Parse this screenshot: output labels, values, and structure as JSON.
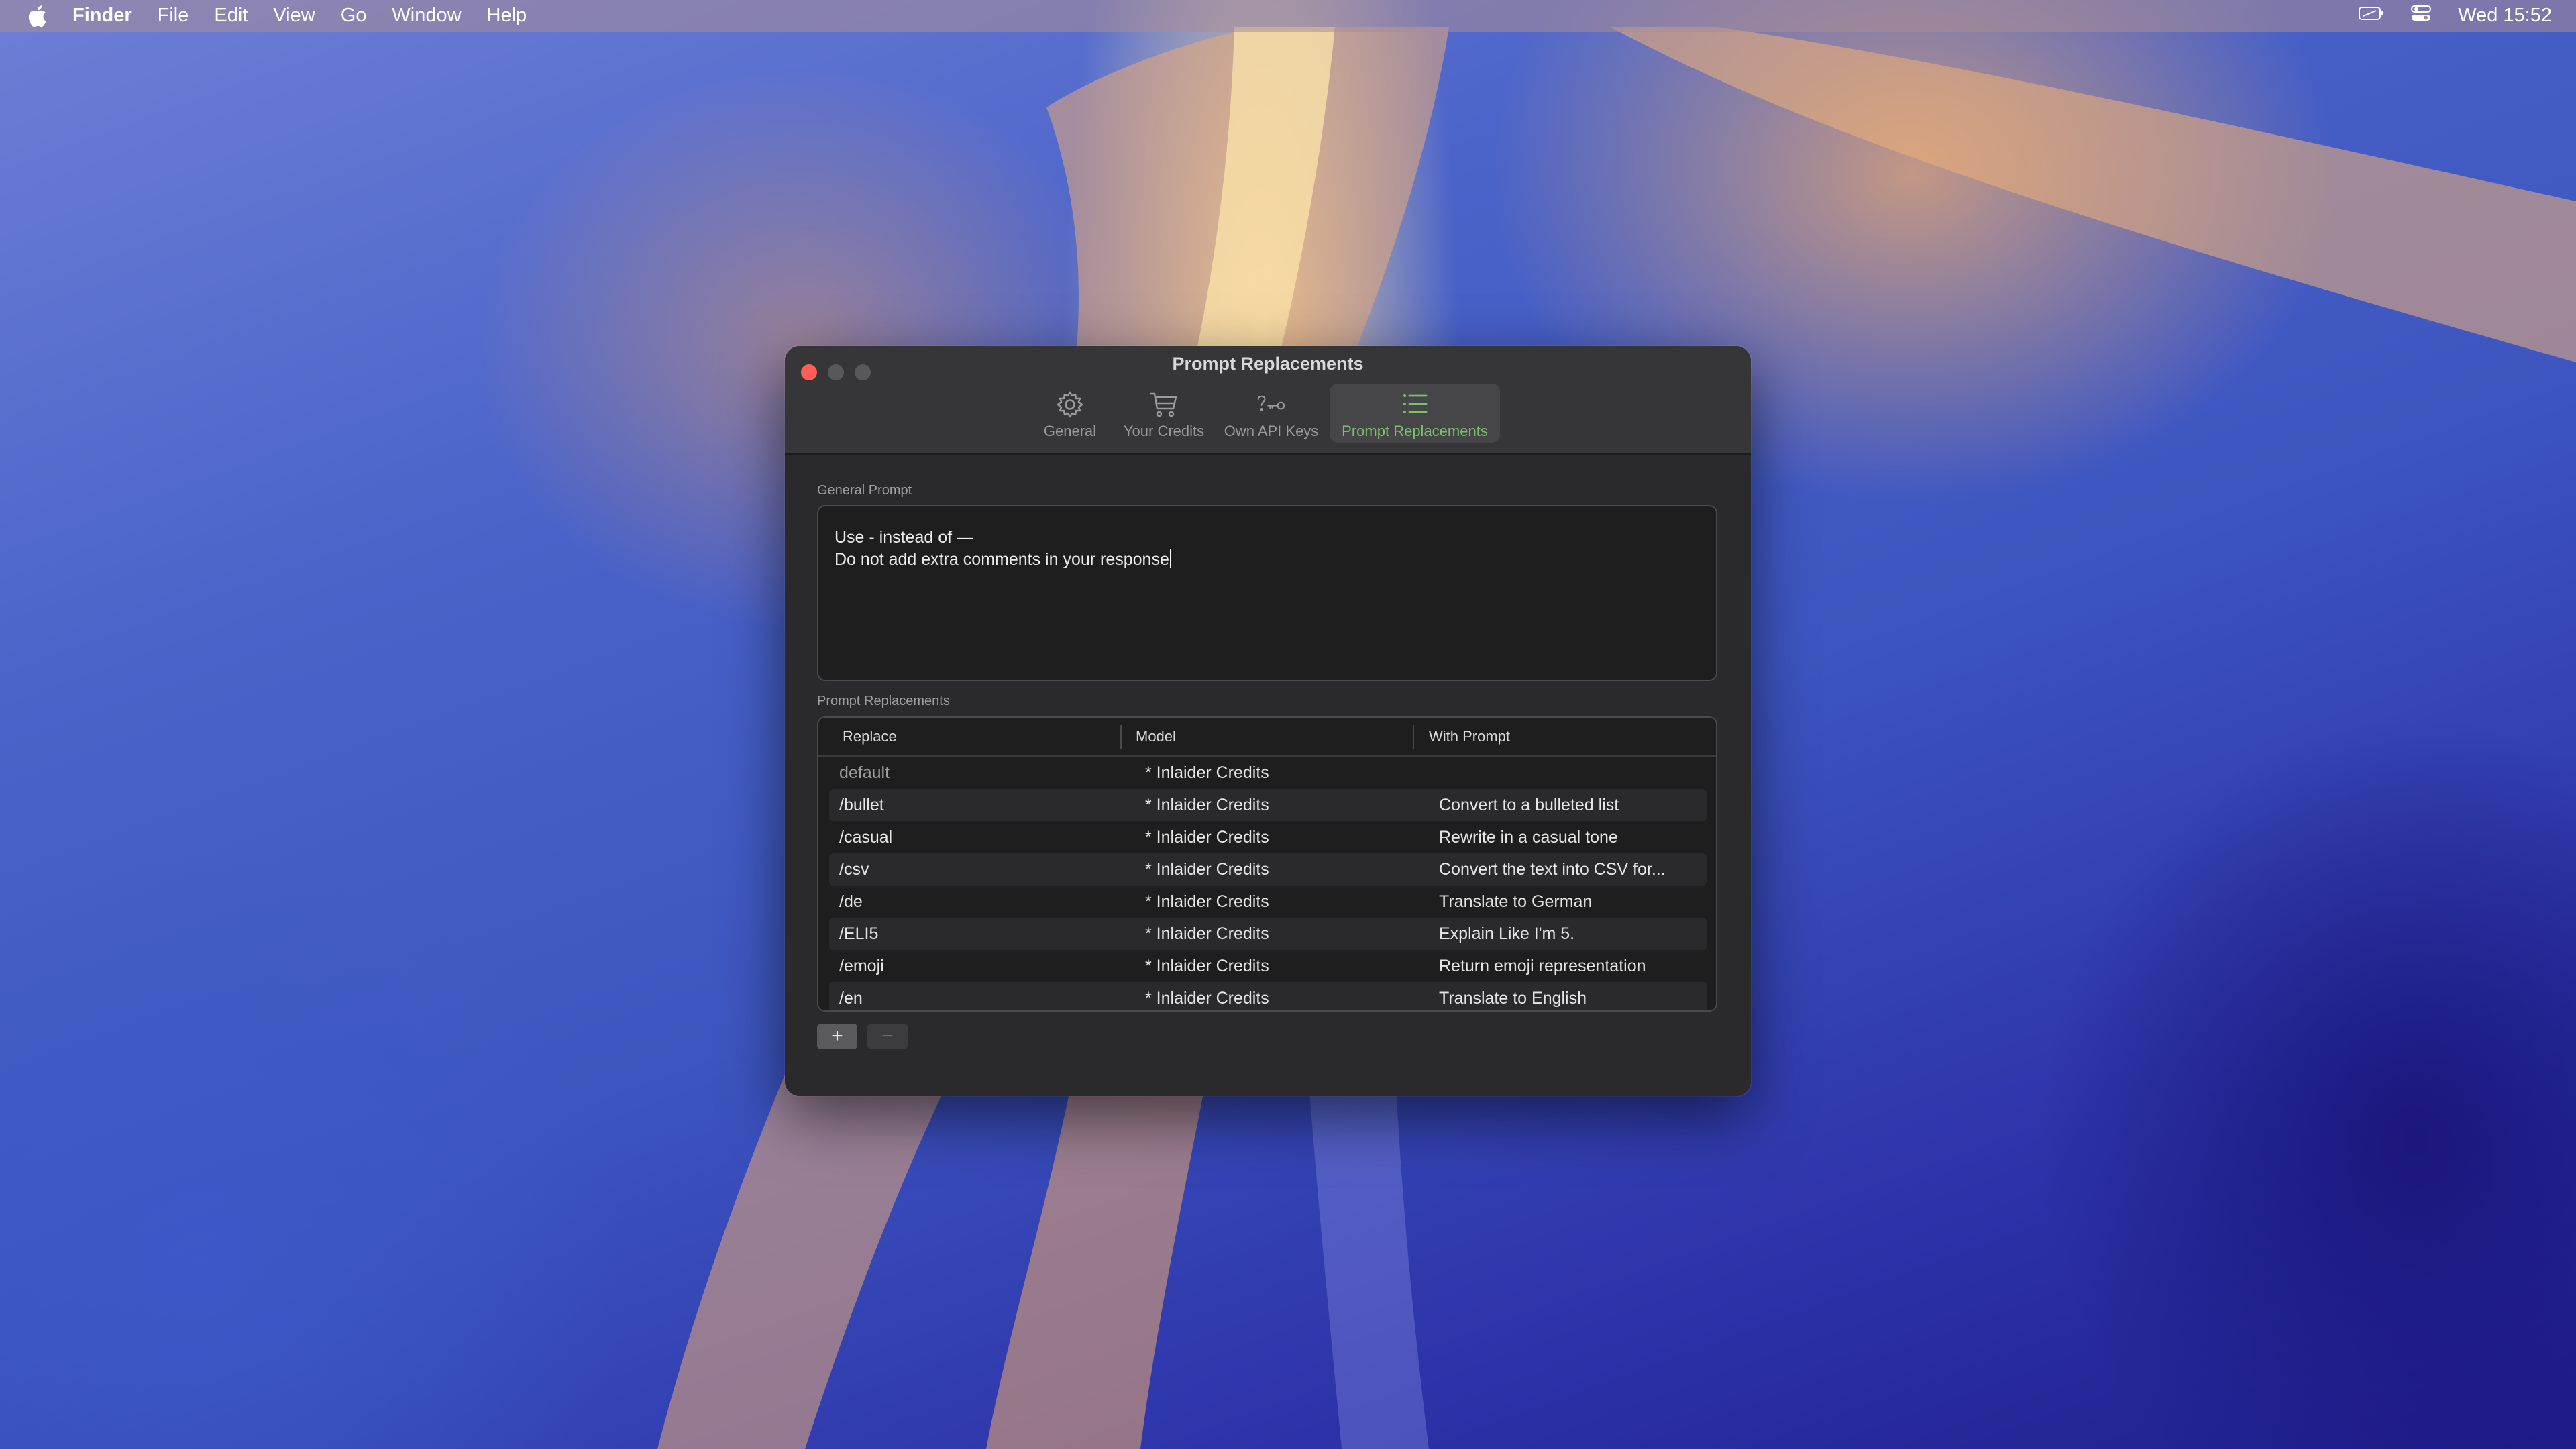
{
  "menubar": {
    "app_name": "Finder",
    "items": [
      "File",
      "Edit",
      "View",
      "Go",
      "Window",
      "Help"
    ],
    "clock": "Wed 15:52",
    "icons": [
      "apple-icon",
      "battery-icon",
      "control-center-icon"
    ]
  },
  "window": {
    "title": "Prompt Replacements",
    "tabs": [
      {
        "label": "General",
        "icon": "gear-icon"
      },
      {
        "label": "Your Credits",
        "icon": "cart-icon"
      },
      {
        "label": "Own API Keys",
        "icon": "question-key-icon"
      },
      {
        "label": "Prompt Replacements",
        "icon": "list-icon",
        "active": true
      }
    ],
    "active_color": "#7ac16b"
  },
  "general_prompt": {
    "label": "General Prompt",
    "lines": [
      "Use - instead of —",
      "Do not add extra comments in your response"
    ]
  },
  "replacements": {
    "label": "Prompt Replacements",
    "columns": [
      "Replace",
      "Model",
      "With Prompt"
    ],
    "rows": [
      {
        "replace": "default",
        "model": "* Inlaider Credits",
        "prompt": ""
      },
      {
        "replace": "/bullet",
        "model": "* Inlaider Credits",
        "prompt": "Convert to a bulleted list"
      },
      {
        "replace": "/casual",
        "model": "* Inlaider Credits",
        "prompt": "Rewrite in a casual tone"
      },
      {
        "replace": "/csv",
        "model": "* Inlaider Credits",
        "prompt": "Convert the text into CSV for..."
      },
      {
        "replace": "/de",
        "model": "* Inlaider Credits",
        "prompt": "Translate to German"
      },
      {
        "replace": "/ELI5",
        "model": "* Inlaider Credits",
        "prompt": "Explain Like I'm 5."
      },
      {
        "replace": "/emoji",
        "model": "* Inlaider Credits",
        "prompt": "Return emoji representation"
      },
      {
        "replace": "/en",
        "model": "* Inlaider Credits",
        "prompt": "Translate to English"
      }
    ],
    "add_label": "+",
    "remove_label": "−"
  }
}
